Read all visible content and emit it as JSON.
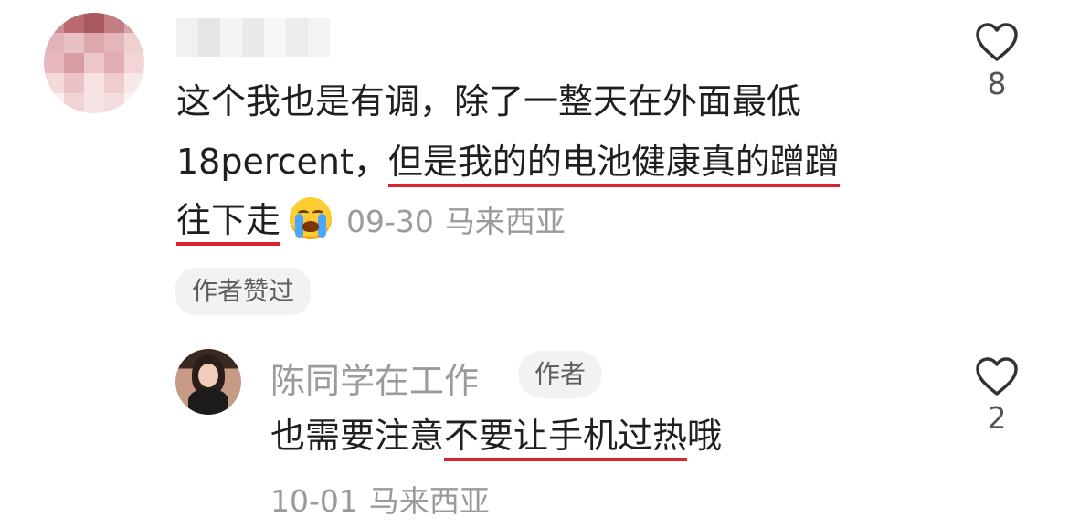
{
  "comment": {
    "line1": "这个我也是有调，除了一整天在外面最低",
    "line2_a": "18percent，",
    "line2_b": "但是我的的电池健康真的蹭蹭",
    "line3": "往下走",
    "date": "09-30",
    "location": "马来西亚",
    "badge": "作者赞过",
    "like_count": "8",
    "emoji": "loudly-crying-face",
    "underline_color": "#d9252f"
  },
  "reply": {
    "author": "陈同学在工作",
    "author_badge": "作者",
    "text_a": "也需要注意",
    "text_b": "不要让手机过热",
    "text_c": "哦",
    "date": "10-01",
    "location": "马来西亚",
    "like_count": "2"
  },
  "icons": {
    "like": "heart-outline-icon"
  }
}
